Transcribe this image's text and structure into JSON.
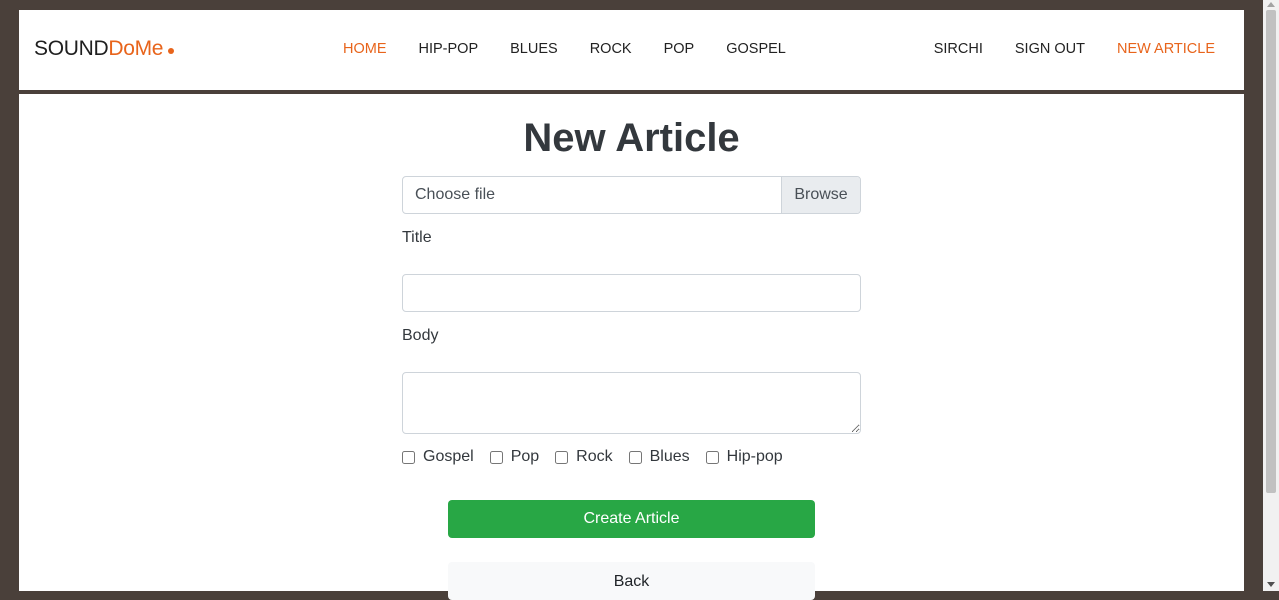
{
  "brand": {
    "part1": "SOUND",
    "part2": "DoMe"
  },
  "nav": {
    "center": [
      "HOME",
      "HIP-POP",
      "BLUES",
      "ROCK",
      "POP",
      "GOSPEL"
    ],
    "right": [
      "SIRCHI",
      "SIGN OUT",
      "NEW ARTICLE"
    ],
    "active_color": "#e8641b"
  },
  "page": {
    "title": "New Article"
  },
  "form": {
    "file_label": "Choose file",
    "browse_label": "Browse",
    "title_label": "Title",
    "title_value": "",
    "body_label": "Body",
    "body_value": "",
    "categories": [
      "Gospel",
      "Pop",
      "Rock",
      "Blues",
      "Hip-pop"
    ],
    "create_label": "Create Article",
    "back_label": "Back"
  },
  "colors": {
    "create_button": "#28a745",
    "frame": "#4a403a"
  }
}
